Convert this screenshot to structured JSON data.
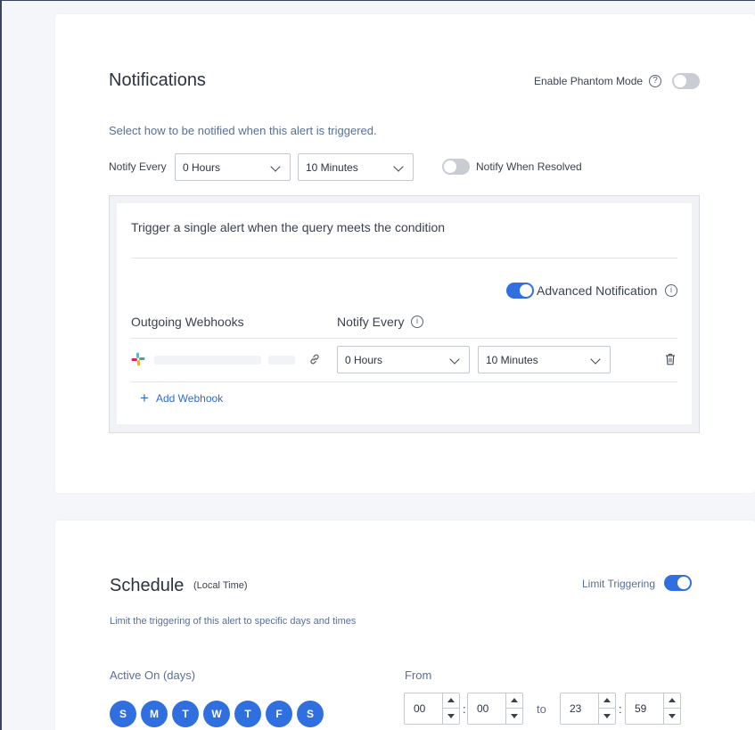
{
  "notifications": {
    "title": "Notifications",
    "phantom_mode_label": "Enable Phantom Mode",
    "phantom_mode_on": false,
    "subtitle": "Select how to be notified when this alert is triggered.",
    "notify_every_label": "Notify Every",
    "hours_value": "0 Hours",
    "minutes_value": "10 Minutes",
    "notify_when_resolved_label": "Notify When Resolved",
    "notify_when_resolved_on": false,
    "panel": {
      "description": "Trigger a single alert when the query meets the condition",
      "advanced_label": "Advanced Notification",
      "advanced_on": true,
      "col_webhooks": "Outgoing Webhooks",
      "col_notify_every": "Notify Every",
      "webhook_row": {
        "icon": "slack-icon",
        "hours_value": "0 Hours",
        "minutes_value": "10 Minutes"
      },
      "add_webhook_label": "Add Webhook"
    }
  },
  "schedule": {
    "title": "Schedule",
    "title_suffix": "(Local Time)",
    "limit_triggering_label": "Limit Triggering",
    "limit_triggering_on": true,
    "subtitle": "Limit the triggering of this alert to specific days and times",
    "active_on_label": "Active On (days)",
    "days": [
      "S",
      "M",
      "T",
      "W",
      "T",
      "F",
      "S"
    ],
    "from_label": "From",
    "from_hour": "00",
    "from_minute": "00",
    "to_label": "to",
    "to_hour": "23",
    "to_minute": "59"
  },
  "colors": {
    "accent": "#2f6fe0",
    "subtitle_blue": "#5a6f96",
    "link_blue": "#2d6bd6"
  }
}
